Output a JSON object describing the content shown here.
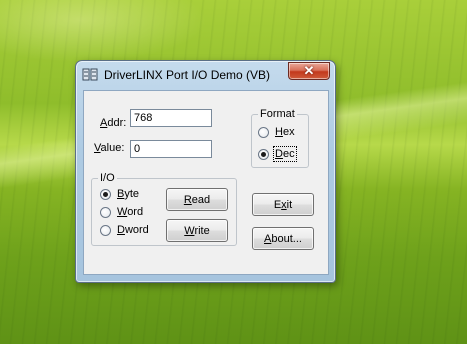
{
  "window": {
    "title": "DriverLINX Port I/O Demo (VB)",
    "close_glyph": "✕"
  },
  "fields": {
    "addr": {
      "label_accel": "A",
      "label_rest": "ddr:",
      "value": "768"
    },
    "value": {
      "label_accel": "V",
      "label_rest": "alue:",
      "value": "0"
    }
  },
  "format": {
    "title": "Format",
    "options": [
      {
        "accel": "H",
        "rest": "ex",
        "selected": false
      },
      {
        "accel": "D",
        "rest": "ec",
        "selected": true
      }
    ]
  },
  "io": {
    "title": "I/O",
    "options": [
      {
        "accel": "B",
        "rest": "yte",
        "selected": true
      },
      {
        "accel": "W",
        "rest": "ord",
        "selected": false
      },
      {
        "accel": "D",
        "rest": "word",
        "selected": false
      }
    ]
  },
  "buttons": {
    "read": {
      "accel": "R",
      "rest": "ead"
    },
    "write": {
      "accel": "W",
      "rest": "rite"
    },
    "exit": {
      "pre": "E",
      "accel": "x",
      "rest": "it"
    },
    "about": {
      "accel": "A",
      "rest": "bout..."
    }
  },
  "colors": {
    "titlebar": "#aecbe3",
    "close_button": "#c3391d",
    "client_background": "#f0f0f0"
  },
  "icons": {
    "app": "driverlinx-app-icon",
    "close": "close-icon"
  }
}
